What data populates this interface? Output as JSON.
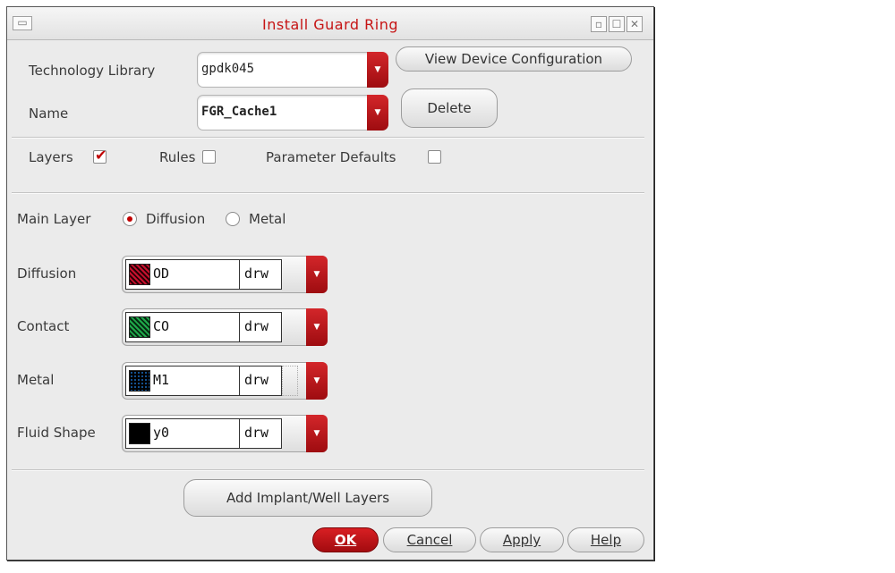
{
  "window": {
    "title": "Install Guard Ring"
  },
  "tech_library": {
    "label": "Technology Library",
    "value": "gpdk045"
  },
  "name_field": {
    "label": "Name",
    "value": "FGR_Cache1"
  },
  "buttons": {
    "view_device_config": "View Device Configuration",
    "delete": "Delete",
    "add_implant": "Add Implant/Well Layers",
    "ok": "OK",
    "cancel": "Cancel",
    "apply": "Apply",
    "help": "Help"
  },
  "tabs": {
    "layers": {
      "label": "Layers",
      "checked": true
    },
    "rules": {
      "label": "Rules",
      "checked": false
    },
    "parameter_defaults": {
      "label": "Parameter Defaults",
      "checked": false
    }
  },
  "main_layer": {
    "label": "Main Layer",
    "options": [
      "Diffusion",
      "Metal"
    ],
    "selected": "Diffusion"
  },
  "layers": [
    {
      "label": "Diffusion",
      "layer": "OD",
      "purpose": "drw",
      "swatch_color": "#c8102e"
    },
    {
      "label": "Contact",
      "layer": "CO",
      "purpose": "drw",
      "swatch_color": "#1faa4a"
    },
    {
      "label": "Metal",
      "layer": "M1",
      "purpose": "drw",
      "swatch_color": "#1a6bbf"
    },
    {
      "label": "Fluid Shape",
      "layer": "y0",
      "purpose": "drw",
      "swatch_color": "#000000"
    }
  ],
  "colors": {
    "accent_red": "#c61414",
    "dialog_bg": "#ebebeb"
  }
}
